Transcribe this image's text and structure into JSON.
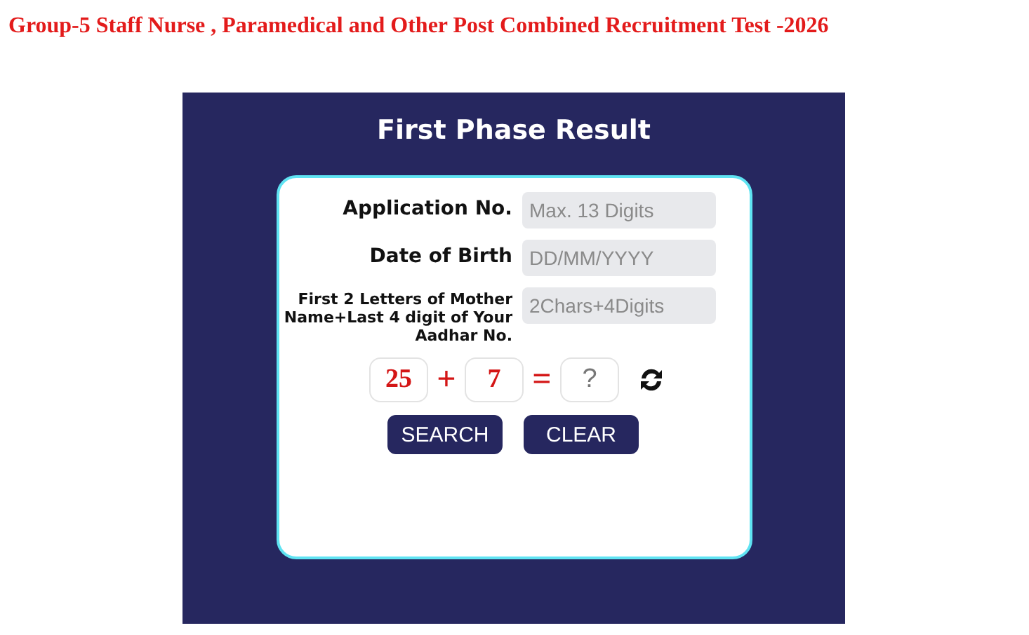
{
  "heading": "Group-5 Staff Nurse , Paramedical and Other Post Combined Recruitment Test -2026",
  "panel": {
    "title": "First Phase Result"
  },
  "fields": [
    {
      "label": "Application No.",
      "placeholder": "Max. 13 Digits"
    },
    {
      "label": "Date of Birth",
      "placeholder": "DD/MM/YYYY"
    },
    {
      "label": "First 2 Letters of Mother Name+Last 4 digit of Your Aadhar No.",
      "placeholder": "2Chars+4Digits"
    }
  ],
  "captcha": {
    "first": "25",
    "operator": "+",
    "second": "7",
    "equals": "=",
    "answer_placeholder": "?"
  },
  "buttons": [
    "SEARCH",
    "CLEAR"
  ]
}
